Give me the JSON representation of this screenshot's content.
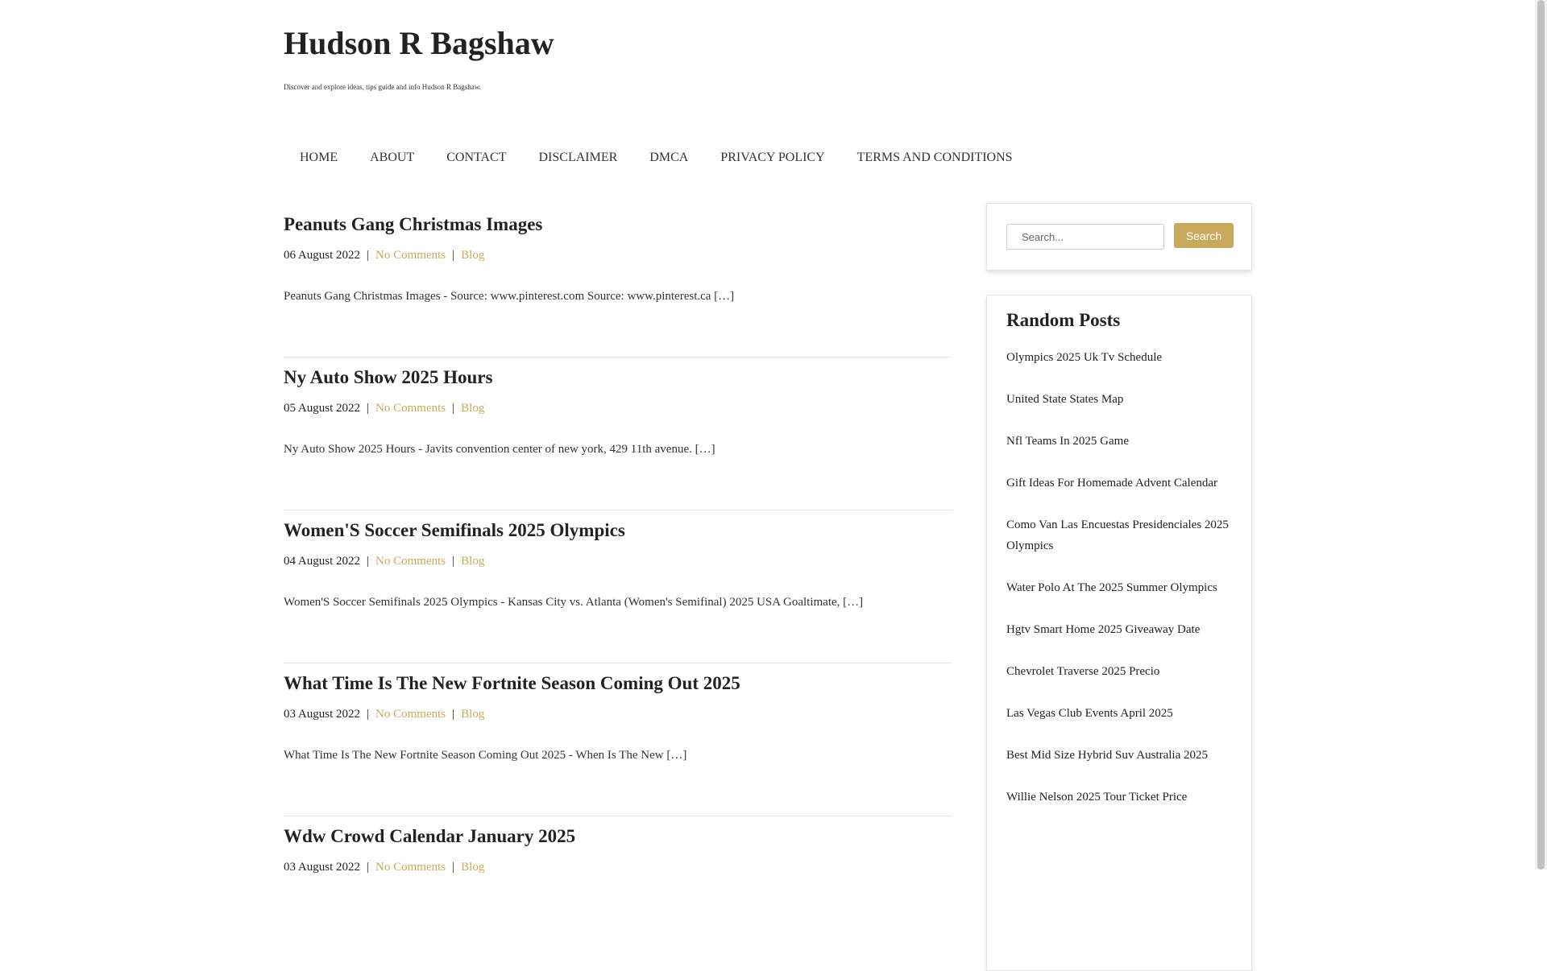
{
  "site": {
    "title": "Hudson R Bagshaw",
    "description": "Discover and explore ideas, tips guide and info Hudson R Bagshaw."
  },
  "nav": [
    "HOME",
    "ABOUT",
    "CONTACT",
    "DISCLAIMER",
    "DMCA",
    "PRIVACY POLICY",
    "TERMS AND CONDITIONS"
  ],
  "posts": [
    {
      "title": "Peanuts Gang Christmas Images",
      "date": "06 August 2022",
      "comments": "No Comments",
      "category": "Blog",
      "excerpt": "Peanuts Gang Christmas Images - Source: www.pinterest.com Source: www.pinterest.ca […]"
    },
    {
      "title": "Ny Auto Show 2025 Hours",
      "date": "05 August 2022",
      "comments": "No Comments",
      "category": "Blog",
      "excerpt": "Ny Auto Show 2025 Hours - Javits convention center of new york, 429 11th avenue. […]"
    },
    {
      "title": "Women'S Soccer Semifinals 2025 Olympics",
      "date": "04 August 2022",
      "comments": "No Comments",
      "category": "Blog",
      "excerpt": "Women'S Soccer Semifinals 2025 Olympics - Kansas City vs. Atlanta (Women's Semifinal) 2025 USA Goaltimate, […]"
    },
    {
      "title": "What Time Is The New Fortnite Season Coming Out 2025",
      "date": "03 August 2022",
      "comments": "No Comments",
      "category": "Blog",
      "excerpt": "What Time Is The New Fortnite Season Coming Out 2025 - When Is The New […]"
    },
    {
      "title": "Wdw Crowd Calendar January 2025",
      "date": "03 August 2022",
      "comments": "No Comments",
      "category": "Blog",
      "excerpt": ""
    }
  ],
  "meta_separator": "|",
  "search": {
    "placeholder": "Search...",
    "button": "Search"
  },
  "random_posts": {
    "title": "Random Posts",
    "items": [
      "Olympics 2025 Uk Tv Schedule",
      "United State States Map",
      "Nfl Teams In 2025 Game",
      "Gift Ideas For Homemade Advent Calendar",
      "Como Van Las Encuestas Presidenciales 2025 Olympics",
      "Water Polo At The 2025 Summer Olympics",
      "Hgtv Smart Home 2025 Giveaway Date",
      "Chevrolet Traverse 2025 Precio",
      "Las Vegas Club Events April 2025",
      "Best Mid Size Hybrid Suv Australia 2025",
      "Willie Nelson 2025 Tour Ticket Price"
    ]
  },
  "colors": {
    "accent": "#c9a95b",
    "text": "#222222",
    "border": "#e5e5e5"
  }
}
